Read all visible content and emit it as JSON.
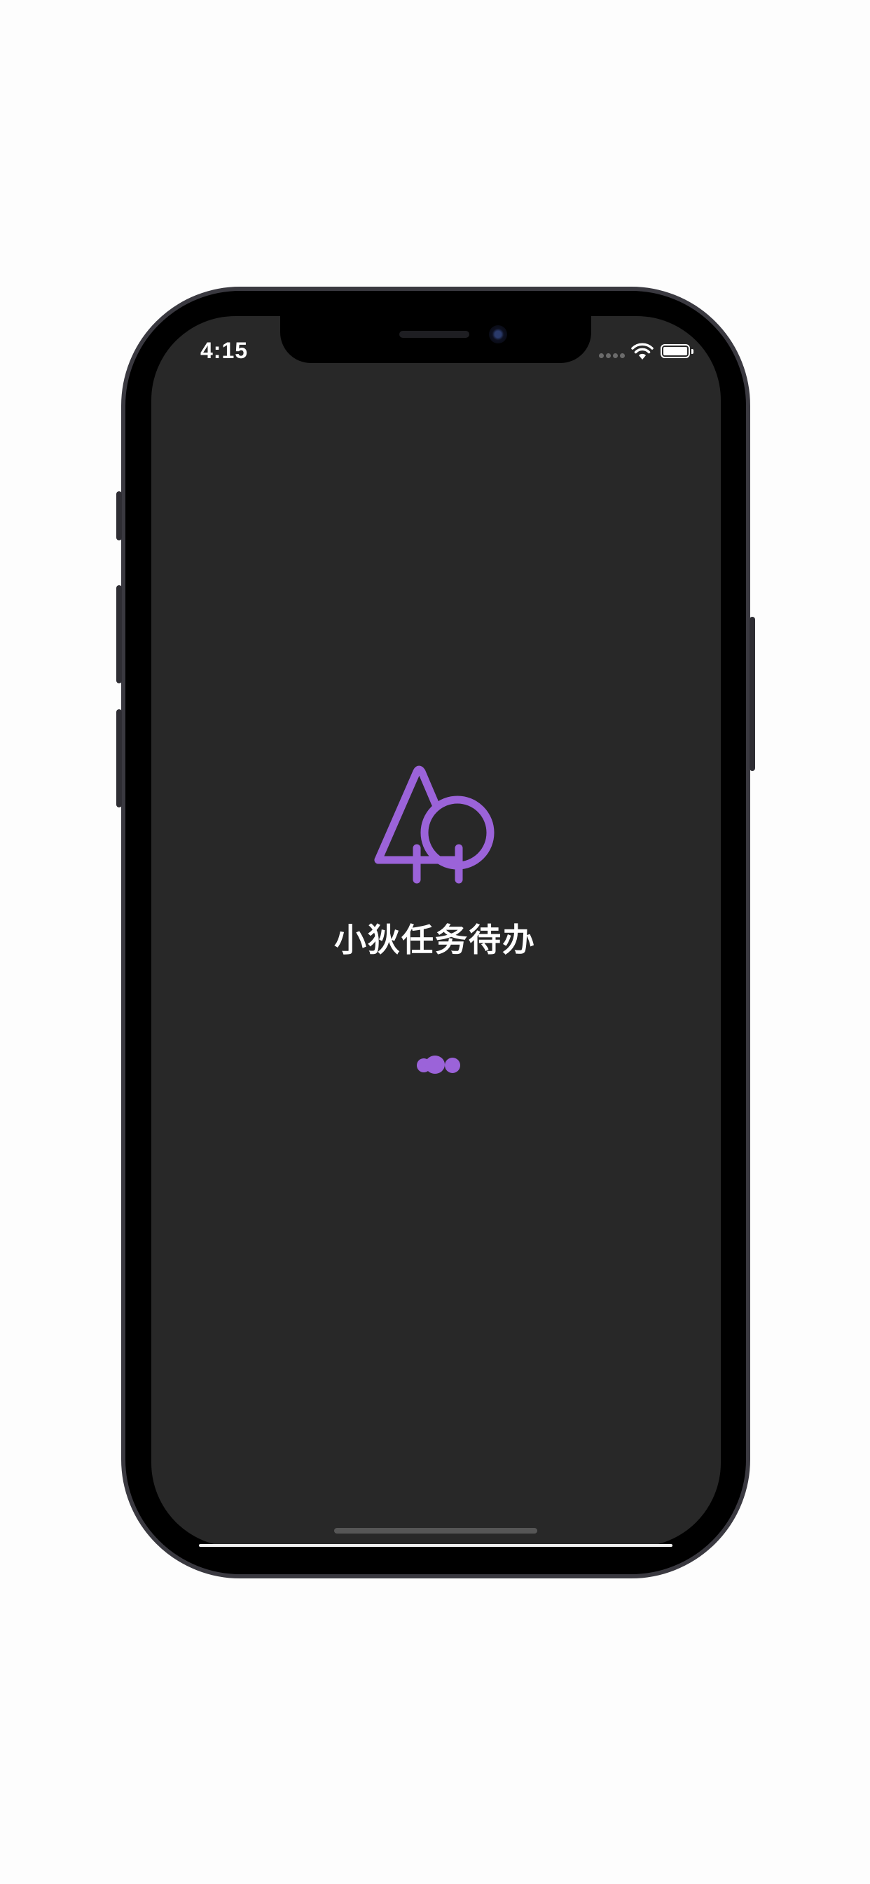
{
  "status_bar": {
    "time": "4:15"
  },
  "splash": {
    "app_title": "小狄任务待办",
    "logo_icon": "tree-logo-icon"
  },
  "colors": {
    "accent": "#9b63d9",
    "screen_background": "#282828",
    "title_text": "#ffffff"
  }
}
